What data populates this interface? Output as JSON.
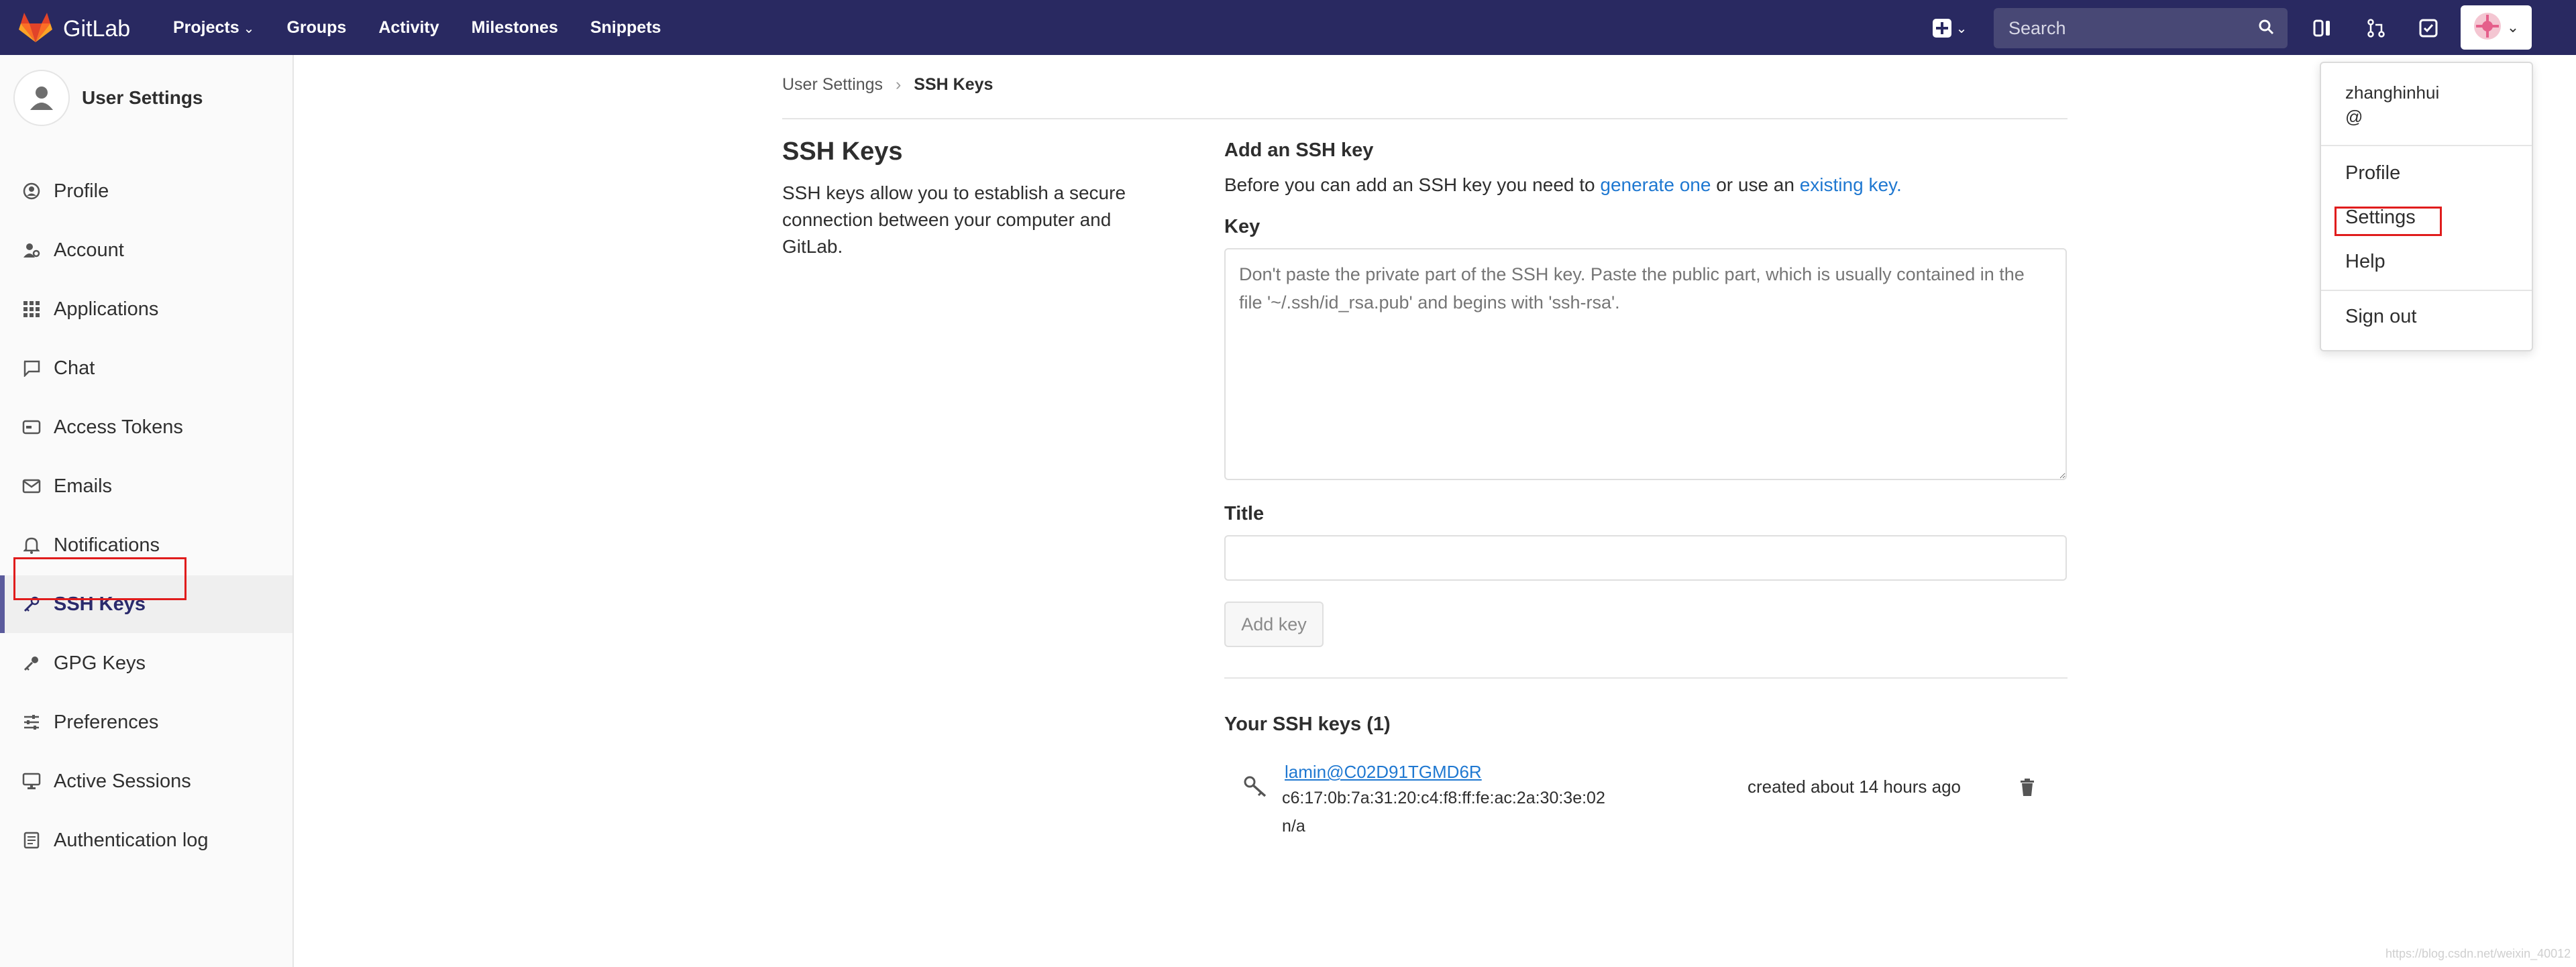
{
  "colors": {
    "nav_bg": "#292961",
    "link": "#1f78d1",
    "highlight": "#e01c1c",
    "active_border": "#5b5b9c"
  },
  "topnav": {
    "brand": "GitLab",
    "links": [
      "Projects",
      "Groups",
      "Activity",
      "Milestones",
      "Snippets"
    ],
    "search_placeholder": "Search",
    "icons": [
      "plus-icon",
      "search-icon",
      "issues-icon",
      "merge-requests-icon",
      "todos-icon",
      "avatar"
    ]
  },
  "sidebar": {
    "user_title": "User Settings",
    "items": [
      {
        "label": "Profile",
        "icon": "profile-icon"
      },
      {
        "label": "Account",
        "icon": "account-icon"
      },
      {
        "label": "Applications",
        "icon": "applications-icon"
      },
      {
        "label": "Chat",
        "icon": "chat-icon"
      },
      {
        "label": "Access Tokens",
        "icon": "token-icon"
      },
      {
        "label": "Emails",
        "icon": "email-icon"
      },
      {
        "label": "Notifications",
        "icon": "bell-icon"
      },
      {
        "label": "SSH Keys",
        "icon": "key-icon",
        "active": true
      },
      {
        "label": "GPG Keys",
        "icon": "key-icon"
      },
      {
        "label": "Preferences",
        "icon": "sliders-icon"
      },
      {
        "label": "Active Sessions",
        "icon": "monitor-icon"
      },
      {
        "label": "Authentication log",
        "icon": "log-icon"
      }
    ]
  },
  "breadcrumb": {
    "parent": "User Settings",
    "current": "SSH Keys"
  },
  "main": {
    "title": "SSH Keys",
    "description": "SSH keys allow you to establish a secure connection between your computer and GitLab.",
    "add_heading": "Add an SSH key",
    "help_prefix": "Before you can add an SSH key you need to",
    "help_link1": "generate one",
    "help_mid": "or use an",
    "help_link2": "existing key.",
    "key_label": "Key",
    "key_placeholder": "Don't paste the private part of the SSH key. Paste the public part, which is usually contained in the file '~/.ssh/id_rsa.pub' and begins with 'ssh-rsa'.",
    "title_label": "Title",
    "add_button": "Add key",
    "your_keys_heading": "Your SSH keys (1)",
    "key_entry": {
      "email": "lamin@C02D91TGMD6R",
      "fingerprint": "c6:17:0b:7a:31:20:c4:f8:ff:fe:ac:2a:30:3e:02",
      "last_used": "n/a",
      "created": "created about 14 hours ago"
    }
  },
  "dropdown": {
    "username": "zhanghinhui",
    "handle": "@",
    "items": [
      "Profile",
      "Settings",
      "Help",
      "Sign out"
    ]
  },
  "watermark": "https://blog.csdn.net/weixin_40012"
}
